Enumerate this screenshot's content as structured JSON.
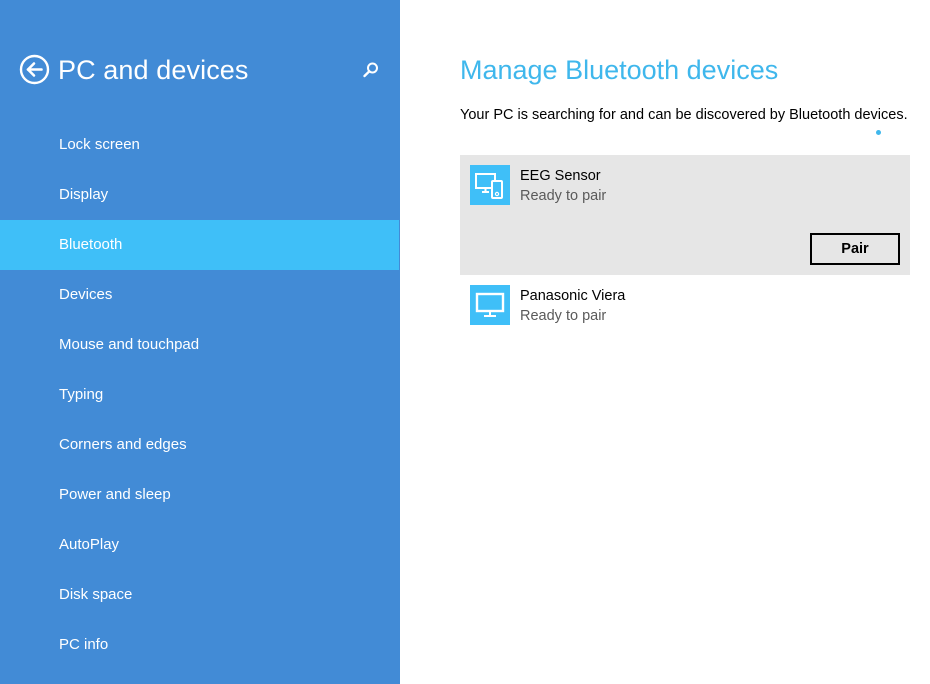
{
  "sidebar": {
    "title": "PC and devices",
    "back_icon": "back-arrow-circle-icon",
    "search_icon": "search-icon",
    "items": [
      {
        "label": "Lock screen",
        "selected": false
      },
      {
        "label": "Display",
        "selected": false
      },
      {
        "label": "Bluetooth",
        "selected": true
      },
      {
        "label": "Devices",
        "selected": false
      },
      {
        "label": "Mouse and touchpad",
        "selected": false
      },
      {
        "label": "Typing",
        "selected": false
      },
      {
        "label": "Corners and edges",
        "selected": false
      },
      {
        "label": "Power and sleep",
        "selected": false
      },
      {
        "label": "AutoPlay",
        "selected": false
      },
      {
        "label": "Disk space",
        "selected": false
      },
      {
        "label": "PC info",
        "selected": false
      }
    ]
  },
  "main": {
    "title": "Manage Bluetooth devices",
    "status": "Your PC is searching for and can be discovered by Bluetooth devices.",
    "devices": [
      {
        "name": "EEG Sensor",
        "status": "Ready to pair",
        "icon": "computer-and-phone-icon",
        "selected": true,
        "action_label": "Pair"
      },
      {
        "name": "Panasonic Viera",
        "status": "Ready to pair",
        "icon": "monitor-icon",
        "selected": false
      }
    ]
  },
  "colors": {
    "sidebar_bg": "#428bd6",
    "selected_item_bg": "#3fbff8",
    "accent": "#3fb7ec",
    "device_selected_bg": "#e6e6e6"
  }
}
